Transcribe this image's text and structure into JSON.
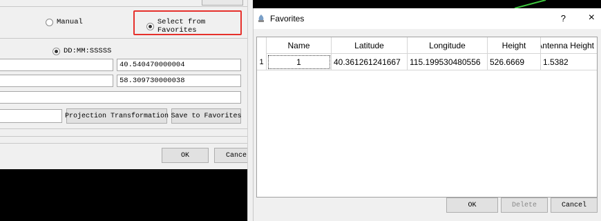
{
  "background_dialog": {
    "manual_radio_label": "Manual",
    "favorites_radio_label": "Select from Favorites",
    "format_radio_label": "DD:MM:SSSSS",
    "field_latitude_value": "40.540470000004",
    "field_height_value": "58.309730000038",
    "projection_button_label": "Projection Transformation",
    "save_favorites_button_label": "Save to Favorites",
    "ok_button_label": "OK",
    "cancel_button_label": "Cancel"
  },
  "favorites_dialog": {
    "title": "Favorites",
    "help_glyph": "?",
    "close_glyph": "×",
    "columns": [
      "Name",
      "Latitude",
      "Longitude",
      "Height",
      "Antenna Height"
    ],
    "rows": [
      {
        "index": "1",
        "name": "1",
        "latitude": "40.361261241667",
        "longitude": "115.199530480556",
        "height": "526.6669",
        "antenna_height": "1.5382"
      }
    ],
    "ok_button_label": "OK",
    "delete_button_label": "Delete",
    "cancel_button_label": "Cancel"
  },
  "colors": {
    "highlight_border": "#e6302b",
    "window_bg": "#f0f0f0",
    "backdrop": "#000000"
  }
}
